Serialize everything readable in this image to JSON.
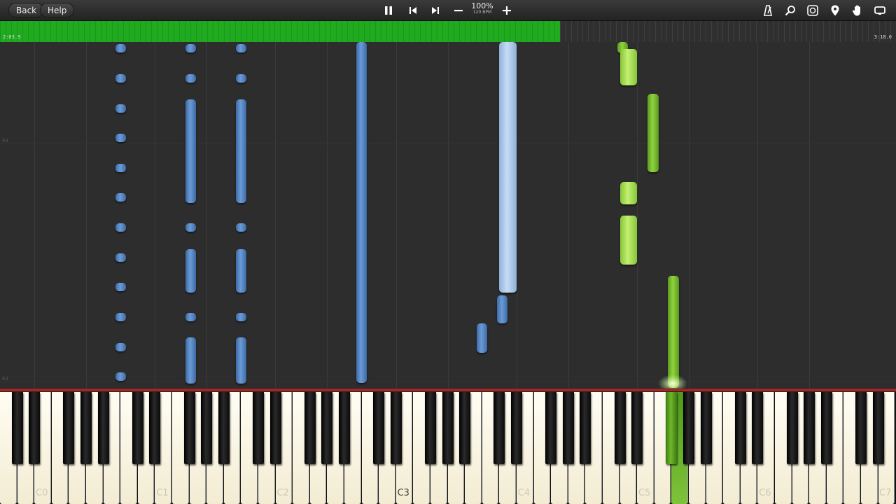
{
  "toolbar": {
    "back_label": "Back",
    "help_label": "Help",
    "speed_percent": "100%",
    "tempo": "120 BPM",
    "icons": [
      "pause-icon",
      "skip-back-icon",
      "skip-forward-icon",
      "minus-icon",
      "plus-icon",
      "metronome-icon",
      "search-icon",
      "loop-icon",
      "location-pin-icon",
      "hand-icon",
      "display-icon"
    ]
  },
  "progress": {
    "current_time": "2:03.9",
    "total_time": "3:18.0",
    "fraction": 0.625
  },
  "roll": {
    "measure_labels": [
      "64",
      "63"
    ]
  },
  "keyboard": {
    "octave_labels": [
      "C0",
      "C1",
      "C2",
      "C3",
      "C4",
      "C5",
      "C6",
      "C7"
    ],
    "active_octave": "C3"
  },
  "colors": {
    "progress": "#1faa1f",
    "left_hand": "#4f7fc0",
    "right_hand": "#7ec43a"
  }
}
